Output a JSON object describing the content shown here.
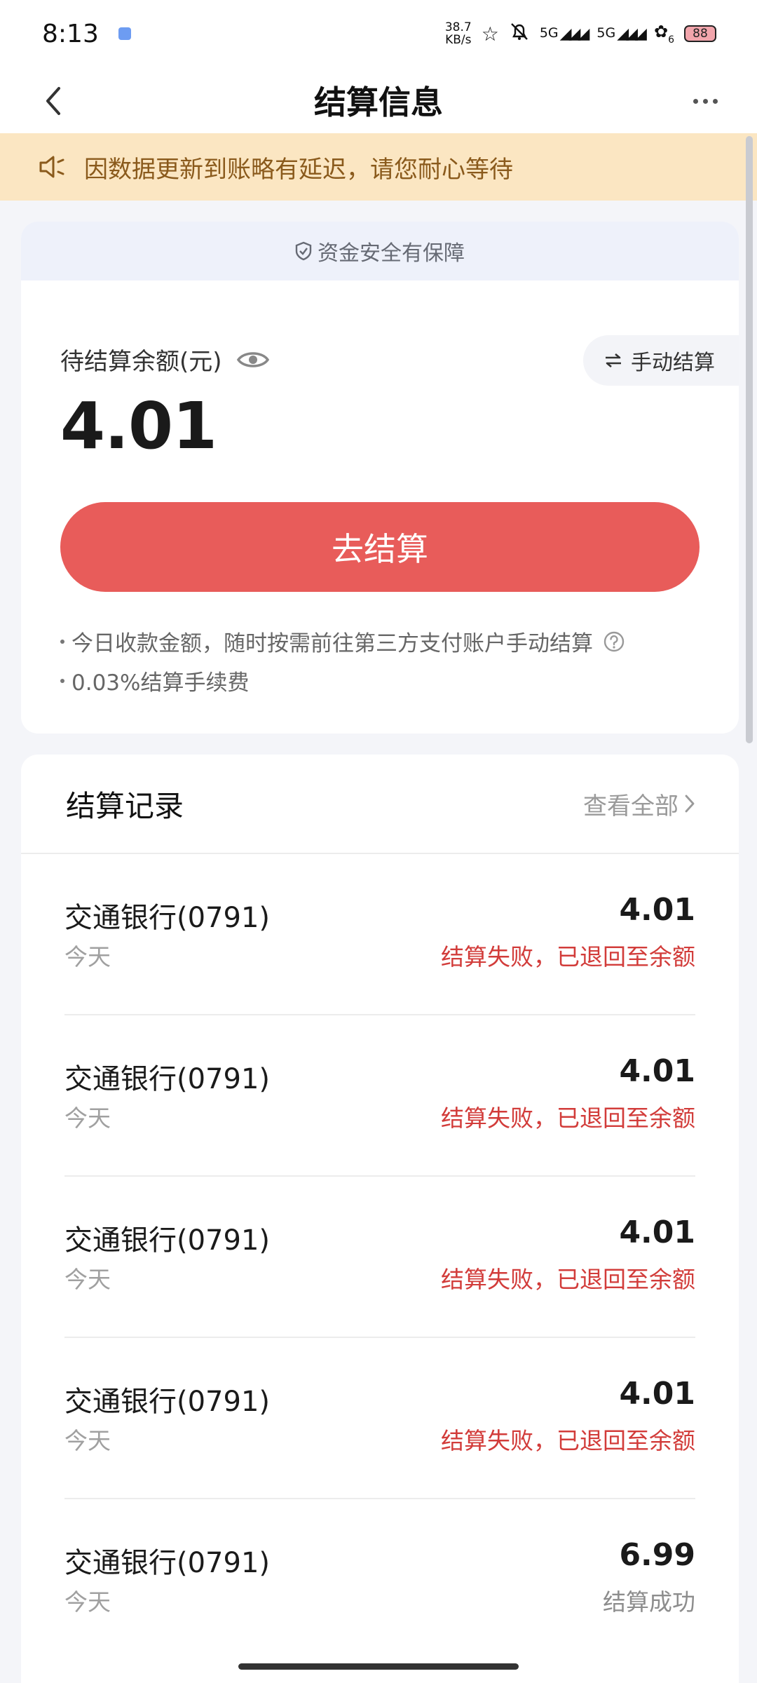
{
  "status_bar": {
    "time": "8:13",
    "speed_value": "38.7",
    "speed_unit": "KB/s",
    "network_1": "5G",
    "network_2": "5G",
    "network_sub": "6",
    "battery": "88"
  },
  "navbar": {
    "title": "结算信息"
  },
  "notice": {
    "text": "因数据更新到账略有延迟，请您耐心等待"
  },
  "balance_card": {
    "safety_text": "资金安全有保障",
    "label": "待结算余额(元)",
    "amount": "4.01",
    "manual_label": "手动结算",
    "settle_button": "去结算",
    "tips": [
      "今日收款金额，随时按需前往第三方支付账户手动结算",
      "0.03%结算手续费"
    ]
  },
  "records": {
    "title": "结算记录",
    "view_all": "查看全部",
    "items": [
      {
        "bank": "交通银行(0791)",
        "date": "今天",
        "amount": "4.01",
        "status": "结算失败，已退回至余额",
        "state": "fail"
      },
      {
        "bank": "交通银行(0791)",
        "date": "今天",
        "amount": "4.01",
        "status": "结算失败，已退回至余额",
        "state": "fail"
      },
      {
        "bank": "交通银行(0791)",
        "date": "今天",
        "amount": "4.01",
        "status": "结算失败，已退回至余额",
        "state": "fail"
      },
      {
        "bank": "交通银行(0791)",
        "date": "今天",
        "amount": "4.01",
        "status": "结算失败，已退回至余额",
        "state": "fail"
      },
      {
        "bank": "交通银行(0791)",
        "date": "今天",
        "amount": "6.99",
        "status": "结算成功",
        "state": "success"
      }
    ]
  },
  "colors": {
    "accent_red": "#e85c5a",
    "fail_text": "#d23c3a",
    "notice_bg": "#fbe6c2",
    "notice_text": "#8a5a1c"
  },
  "icons": {
    "back": "chevron-left-icon",
    "more": "more-dots-icon",
    "notice": "speaker-icon",
    "safety": "shield-icon",
    "eye": "eye-icon",
    "manual": "swap-arrows-icon",
    "help": "question-circle-icon",
    "view_all": "chevron-right-icon"
  }
}
